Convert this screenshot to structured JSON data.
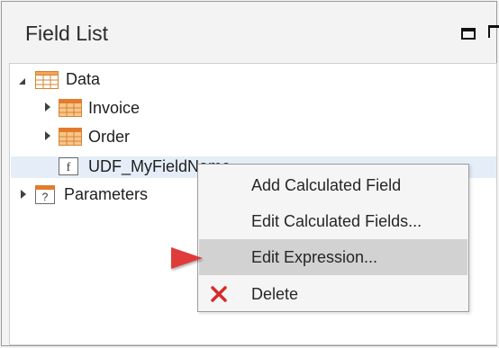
{
  "panel": {
    "title": "Field List"
  },
  "tree": {
    "root": {
      "label": "Data",
      "icon": "table-icon",
      "expanded": true
    },
    "children": [
      {
        "label": "Invoice",
        "icon": "table-icon",
        "expanded": false
      },
      {
        "label": "Order",
        "icon": "table-icon",
        "expanded": false
      },
      {
        "label": "UDF_MyFieldName",
        "icon": "field-icon",
        "icon_glyph": "f",
        "selected": true
      }
    ],
    "parameters": {
      "label": "Parameters",
      "icon": "parameter-icon",
      "icon_glyph": "?",
      "expanded": false
    }
  },
  "context_menu": {
    "items": [
      {
        "label": "Add Calculated Field"
      },
      {
        "label": "Edit Calculated Fields..."
      },
      {
        "label": "Edit Expression...",
        "active": true
      },
      {
        "label": "Delete",
        "icon": "delete-x-icon"
      }
    ]
  },
  "annotation": {
    "type": "arrow",
    "color": "#e03a3a",
    "points_to": "Edit Expression..."
  },
  "colors": {
    "highlight": "#e5eef8",
    "menu_active": "#d2d2d2",
    "delete_icon": "#d72a2a",
    "table_icon_orange": "#e8792b"
  }
}
